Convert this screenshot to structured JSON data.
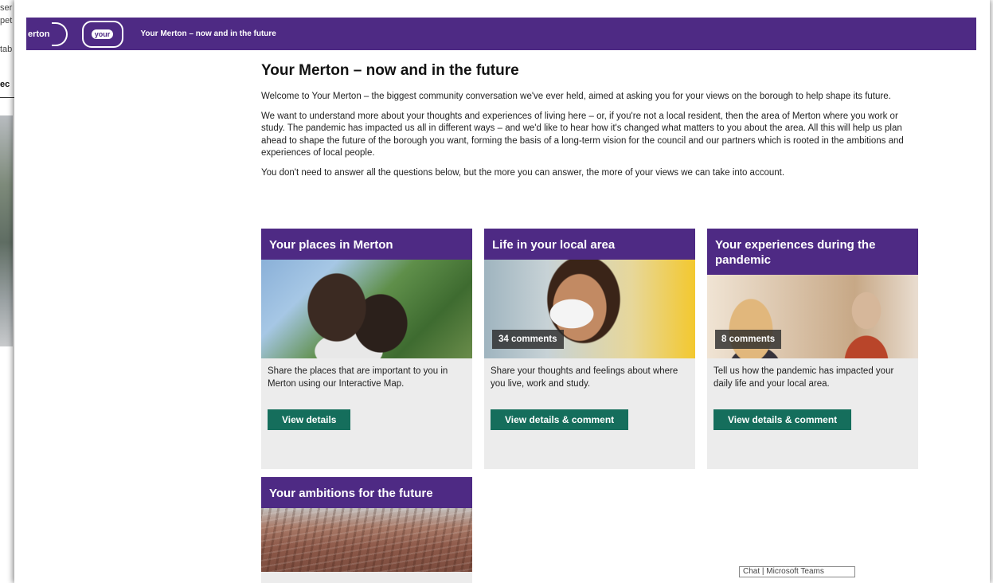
{
  "background_fragments": [
    "ser",
    "pet",
    "tab",
    "ec"
  ],
  "header": {
    "merton_logo_text": "erton",
    "yours_logo_text": "your",
    "title": "Your Merton – now and in the future"
  },
  "page": {
    "heading": "Your Merton – now and in the future",
    "paragraphs": [
      "Welcome to Your Merton – the biggest community conversation we've ever held, aimed at asking you for your views on the borough to help shape its future.",
      "We want to understand more about your thoughts and experiences of living here – or, if you're not a local resident, then the area of Merton where you work or study. The pandemic has impacted us all in different ways – and we'd like to hear how it's changed what matters to you about the area. All this will help us plan ahead to shape the future of the borough you want, forming the basis of a long-term vision for the council and our partners which is rooted in the ambitions and experiences of local people.",
      "You don't need to answer all the questions below, but the more you can answer, the more of your views we can take into account."
    ]
  },
  "cards": [
    {
      "title": "Your places in Merton",
      "comments": "",
      "body": "Share the places that are important to you in Merton using our Interactive Map.",
      "button": "View details"
    },
    {
      "title": "Life in your local area",
      "comments": "34 comments",
      "body": "Share your thoughts and feelings about where you live, work and study.",
      "button": "View details & comment"
    },
    {
      "title": "Your experiences during the pandemic",
      "comments": "8 comments",
      "body": "Tell us how the pandemic has impacted your daily life and your local area.",
      "button": "View details & comment"
    },
    {
      "title": "Your ambitions for the future"
    }
  ],
  "taskbar_chip": "Chat | Microsoft Teams"
}
